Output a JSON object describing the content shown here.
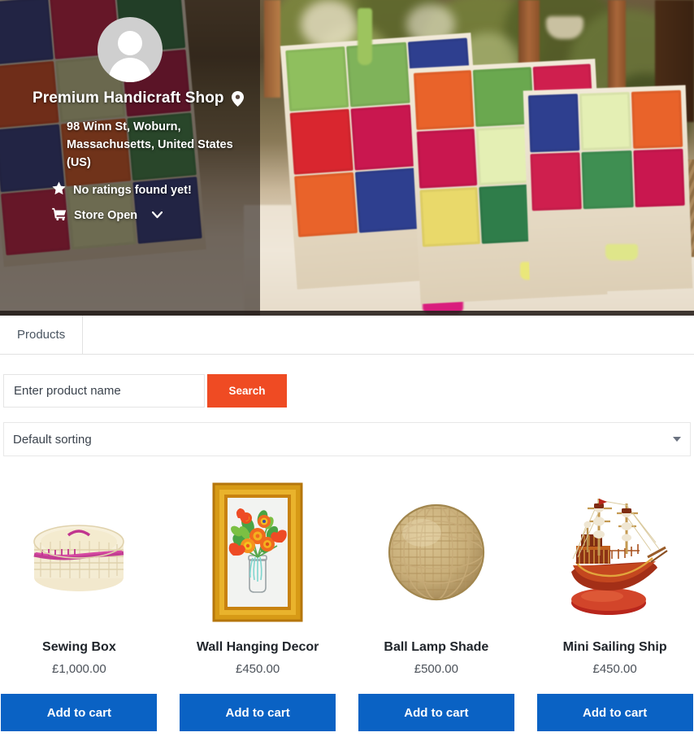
{
  "store": {
    "name": "Premium Handicraft Shop",
    "address": "98 Winn St, Woburn, Massachusetts, United States (US)",
    "rating_text": "No ratings found yet!",
    "status_text": "Store Open",
    "icons": {
      "location": "map-pin-icon",
      "rating": "star-icon",
      "status": "shopping-cart-icon",
      "status_toggle": "chevron-down-icon",
      "avatar": "user-avatar-icon"
    }
  },
  "tabs": [
    {
      "label": "Products",
      "active": true
    }
  ],
  "search": {
    "placeholder": "Enter product name",
    "value": "",
    "button_label": "Search"
  },
  "sorting": {
    "selected": "Default sorting",
    "caret_icon": "chevron-down-icon"
  },
  "products": [
    {
      "name": "Sewing Box",
      "price": "£1,000.00",
      "image": "woven-sewing-box-image",
      "button_label": "Add to cart"
    },
    {
      "name": "Wall Hanging Decor",
      "price": "£450.00",
      "image": "framed-flower-art-image",
      "button_label": "Add to cart"
    },
    {
      "name": "Ball Lamp Shade",
      "price": "£500.00",
      "image": "rattan-ball-lamp-image",
      "button_label": "Add to cart"
    },
    {
      "name": "Mini Sailing Ship",
      "price": "£450.00",
      "image": "model-sailing-ship-image",
      "button_label": "Add to cart"
    }
  ],
  "colors": {
    "search_button": "#ef4b23",
    "add_to_cart_button": "#0a62c4",
    "overlay": "rgba(25,18,14,0.58)",
    "text_dark": "#20252b"
  }
}
